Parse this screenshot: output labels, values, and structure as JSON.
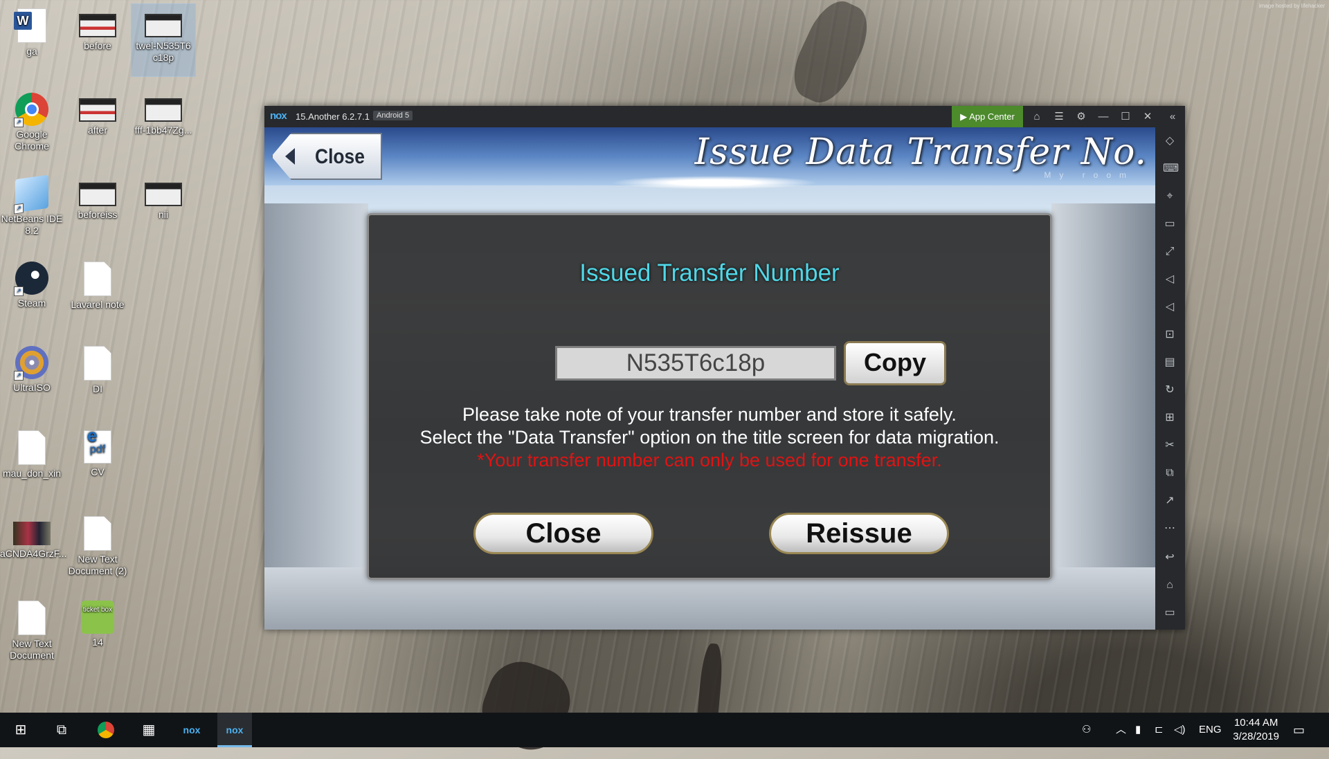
{
  "watermark": "image hosted by lifehacker",
  "desktop": {
    "icons": [
      {
        "label": "ga"
      },
      {
        "label": "before"
      },
      {
        "label": "twel-N535T6 c18p"
      },
      {
        "label": "Google Chrome"
      },
      {
        "label": "after"
      },
      {
        "label": "fff-1bb47Zg..."
      },
      {
        "label": "NetBeans IDE 8.2"
      },
      {
        "label": "beforeiss"
      },
      {
        "label": "nii"
      },
      {
        "label": "Steam"
      },
      {
        "label": "Lavarel note"
      },
      {
        "label": "UltraISO"
      },
      {
        "label": "DI"
      },
      {
        "label": "mau_don_xin"
      },
      {
        "label": "CV"
      },
      {
        "label": "aCNDA4GrzF..."
      },
      {
        "label": "New Text Document (2)"
      },
      {
        "label": "New Text Document"
      },
      {
        "label": "14"
      }
    ],
    "pdf_text": "pdf",
    "ticket_text": "ticket box"
  },
  "nox": {
    "logo": "nox",
    "title": "15.Another 6.2.7.1",
    "android": "Android 5",
    "app_center": "App Center",
    "accent": "#4c8a2c"
  },
  "game": {
    "banner_title": "Issue Data Transfer No.",
    "banner_sub": "My room",
    "top_close": "Close",
    "dialog": {
      "title": "Issued Transfer Number",
      "code": "N535T6c18p",
      "copy": "Copy",
      "line1": "Please take note of your transfer number and store it safely.",
      "line2": "Select the \"Data Transfer\" option on the title screen for data migration.",
      "warning": "*Your transfer number can only be used for one transfer.",
      "close": "Close",
      "reissue": "Reissue"
    }
  },
  "taskbar": {
    "lang": "ENG",
    "time": "10:44 AM",
    "date": "3/28/2019"
  }
}
